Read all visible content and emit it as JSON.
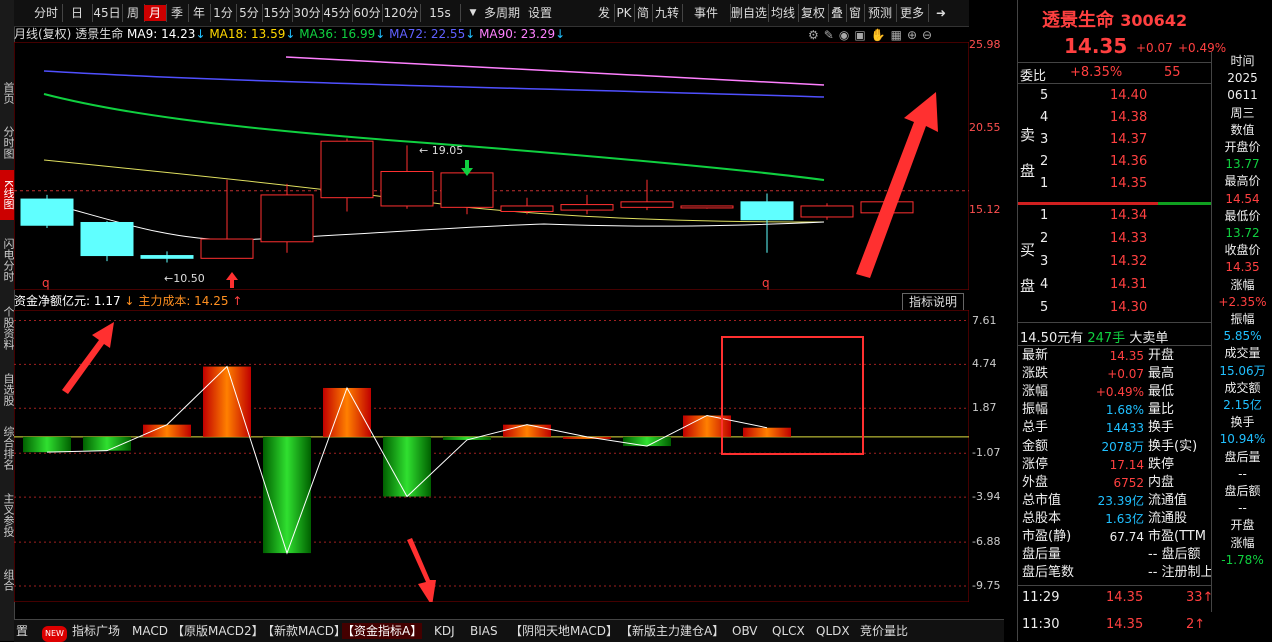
{
  "left_rail": [
    "首页",
    "分时图",
    "K线图",
    "闪电分时",
    "个股资料",
    "自选股",
    "综合排名",
    "主叉参投",
    "组合"
  ],
  "toolbar": {
    "periods": [
      "分时",
      "日",
      "45日",
      "周",
      "月",
      "季",
      "年",
      "1分",
      "5分",
      "15分",
      "30分",
      "45分",
      "60分",
      "120分",
      "15s"
    ],
    "active_period": "月",
    "more_period": "多周期",
    "settings": "设置",
    "tools": [
      "发",
      "PK",
      "简",
      "九转",
      "事件",
      "删自选",
      "均线",
      "复权",
      "叠",
      "窗",
      "预测",
      "更多"
    ]
  },
  "ma_line": {
    "prefix": "月线(复权)",
    "stock": "透景生命",
    "items": [
      {
        "label": "MA9: 14.23",
        "dir": "↓",
        "color": "#ffffff"
      },
      {
        "label": "MA18: 13.59",
        "dir": "↓",
        "color": "#ffd700"
      },
      {
        "label": "MA36: 16.99",
        "dir": "↓",
        "color": "#10d040"
      },
      {
        "label": "MA72: 22.55",
        "dir": "↓",
        "color": "#6060ff"
      },
      {
        "label": "MA90: 23.29",
        "dir": "↓",
        "color": "#ff80ff"
      }
    ]
  },
  "kchart": {
    "axis": [
      "25.98",
      "20.55",
      "15.12"
    ],
    "current_level": "15.12",
    "high_label": "19.05",
    "low_label": "10.50",
    "marker_q": "q",
    "candles": [
      {
        "o": 15.1,
        "c": 13.2,
        "h": 15.4,
        "l": 13.0
      },
      {
        "o": 13.4,
        "c": 11.0,
        "h": 13.5,
        "l": 10.6
      },
      {
        "o": 11.0,
        "c": 10.8,
        "h": 11.3,
        "l": 10.5
      },
      {
        "o": 10.8,
        "c": 12.2,
        "h": 16.5,
        "l": 10.8
      },
      {
        "o": 12.0,
        "c": 15.4,
        "h": 16.2,
        "l": 11.2
      },
      {
        "o": 15.2,
        "c": 19.3,
        "h": 19.5,
        "l": 14.2
      },
      {
        "o": 14.6,
        "c": 17.1,
        "h": 19.0,
        "l": 14.4
      },
      {
        "o": 14.5,
        "c": 17.0,
        "h": 17.4,
        "l": 14.0
      },
      {
        "o": 14.2,
        "c": 14.6,
        "h": 15.2,
        "l": 14.0
      },
      {
        "o": 14.3,
        "c": 14.7,
        "h": 15.4,
        "l": 14.0
      },
      {
        "o": 14.5,
        "c": 14.9,
        "h": 16.5,
        "l": 14.3
      },
      {
        "o": 14.5,
        "c": 14.6,
        "h": 14.6,
        "l": 14.4
      },
      {
        "o": 14.9,
        "c": 13.6,
        "h": 15.5,
        "l": 11.2
      },
      {
        "o": 13.8,
        "c": 14.6,
        "h": 14.8,
        "l": 13.6
      },
      {
        "o": 14.1,
        "c": 14.9,
        "h": 15.0,
        "l": 14.0
      }
    ]
  },
  "fund_chart": {
    "title": "资金净额亿元:",
    "value": "1.17",
    "cost_label": "主力成本: 14.25",
    "explain": "指标说明",
    "axis": [
      "7.61",
      "4.74",
      "1.87",
      "-1.07",
      "-3.94",
      "-6.88",
      "-9.75"
    ],
    "values": [
      -1.0,
      -0.9,
      0.8,
      4.6,
      -7.6,
      3.2,
      -3.9,
      -0.2,
      0.8,
      0,
      -0.6,
      1.4,
      0.6
    ]
  },
  "bottom_tabs": [
    "置",
    "NEW",
    "指标广场",
    "MACD",
    "【原版MACD2】",
    "【新款MACD】",
    "【资金指标A】",
    "KDJ",
    "BIAS",
    "【阴阳天地MACD】",
    "【新版主力建仓A】",
    "OBV",
    "QLCX",
    "QLDX",
    "竞价量比"
  ],
  "active_tab": "【资金指标A】",
  "quote": {
    "name": "透景生命",
    "code": "300642",
    "price": "14.35",
    "change": "+0.07",
    "pct": "+0.49%",
    "weibi_label": "委比",
    "weibi": "+8.35%",
    "weicha": "55",
    "sell_label": [
      "卖",
      "盘"
    ],
    "buy_label": [
      "买",
      "盘"
    ],
    "sell": [
      [
        "5",
        "14.40"
      ],
      [
        "4",
        "14.38"
      ],
      [
        "3",
        "14.37"
      ],
      [
        "2",
        "14.36"
      ],
      [
        "1",
        "14.35"
      ]
    ],
    "buy": [
      [
        "1",
        "14.34"
      ],
      [
        "2",
        "14.33"
      ],
      [
        "3",
        "14.32"
      ],
      [
        "4",
        "14.31"
      ],
      [
        "5",
        "14.30"
      ]
    ],
    "big_order": {
      "price": "14.50元有",
      "vol": "247手",
      "text": "大卖单"
    },
    "stats_left": [
      [
        "最新",
        "14.35",
        "red"
      ],
      [
        "涨跌",
        "+0.07",
        "red"
      ],
      [
        "涨幅",
        "+0.49%",
        "red"
      ],
      [
        "振幅",
        "1.68%",
        "cyan"
      ],
      [
        "总手",
        "14433",
        "cyan"
      ],
      [
        "金额",
        "2078万",
        "cyan"
      ],
      [
        "涨停",
        "17.14",
        "red"
      ],
      [
        "外盘",
        "6752",
        "red"
      ],
      [
        "总市值",
        "23.39亿",
        "cyan"
      ],
      [
        "总股本",
        "1.63亿",
        "cyan"
      ],
      [
        "市盈(静)",
        "67.74",
        "white"
      ],
      [
        "盘后量",
        "",
        ""
      ],
      [
        "盘后笔数",
        "",
        ""
      ]
    ],
    "stats_right": [
      "开盘",
      "最高",
      "最低",
      "量比",
      "换手",
      "换手(实)",
      "跌停",
      "内盘",
      "流通值",
      "流通股",
      "市盈(TTM",
      "盘后额",
      "注册制上"
    ],
    "ticks": [
      [
        "11:29",
        "14.35",
        "33"
      ],
      [
        "11:30",
        "14.35",
        "2"
      ]
    ]
  },
  "side_col": [
    [
      "时间",
      "white"
    ],
    [
      "2025",
      "white"
    ],
    [
      "0611",
      "white"
    ],
    [
      "周三",
      "white"
    ],
    [
      "数值",
      "white"
    ],
    [
      "开盘价",
      "white"
    ],
    [
      "13.77",
      "green"
    ],
    [
      "最高价",
      "white"
    ],
    [
      "14.54",
      "red"
    ],
    [
      "最低价",
      "white"
    ],
    [
      "13.72",
      "green"
    ],
    [
      "收盘价",
      "white"
    ],
    [
      "14.35",
      "red"
    ],
    [
      "涨幅",
      "white"
    ],
    [
      "+2.35%",
      "red"
    ],
    [
      "振幅",
      "white"
    ],
    [
      "5.85%",
      "cyan"
    ],
    [
      "成交量",
      "white"
    ],
    [
      "15.06万",
      "cyan"
    ],
    [
      "成交额",
      "white"
    ],
    [
      "2.15亿",
      "cyan"
    ],
    [
      "换手",
      "white"
    ],
    [
      "10.94%",
      "cyan"
    ],
    [
      "盘后量",
      "white"
    ],
    [
      "--",
      "white"
    ],
    [
      "盘后额",
      "white"
    ],
    [
      "--",
      "white"
    ],
    [
      "开盘",
      "white"
    ],
    [
      "涨幅",
      "white"
    ],
    [
      "-1.78%",
      "green"
    ]
  ]
}
